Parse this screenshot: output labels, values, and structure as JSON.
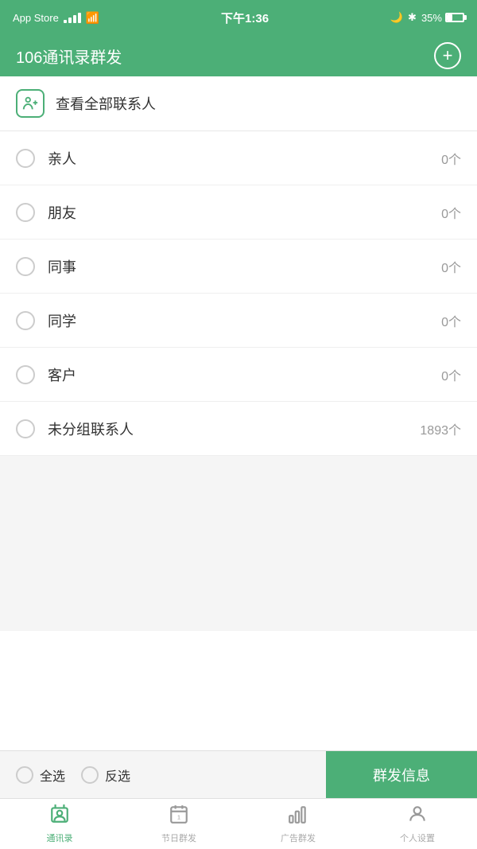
{
  "statusBar": {
    "carrier": "App Store",
    "time": "下午1:36",
    "bluetooth": "✱",
    "battery": "35%"
  },
  "header": {
    "title": "106通讯录群发",
    "addLabel": "+"
  },
  "allContacts": {
    "label": "查看全部联系人"
  },
  "groups": [
    {
      "name": "亲人",
      "count": "0个"
    },
    {
      "name": "朋友",
      "count": "0个"
    },
    {
      "name": "同事",
      "count": "0个"
    },
    {
      "name": "同学",
      "count": "0个"
    },
    {
      "name": "客户",
      "count": "0个"
    },
    {
      "name": "未分组联系人",
      "count": "1893个"
    }
  ],
  "actionBar": {
    "selectAll": "全选",
    "invertSelect": "反选",
    "sendBtn": "群发信息"
  },
  "tabs": [
    {
      "id": "contacts",
      "label": "通讯录",
      "active": true
    },
    {
      "id": "holiday",
      "label": "节日群发",
      "active": false
    },
    {
      "id": "ad",
      "label": "广告群发",
      "active": false
    },
    {
      "id": "settings",
      "label": "个人设置",
      "active": false
    }
  ]
}
